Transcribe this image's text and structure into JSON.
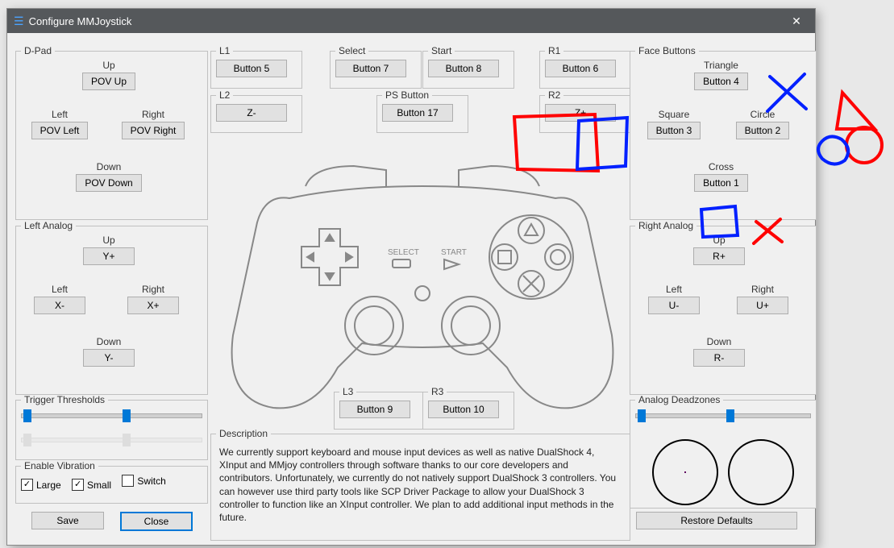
{
  "window": {
    "title": "Configure MMJoystick"
  },
  "dpad": {
    "legend": "D-Pad",
    "up_lbl": "Up",
    "up_btn": "POV Up",
    "left_lbl": "Left",
    "left_btn": "POV Left",
    "right_lbl": "Right",
    "right_btn": "POV Right",
    "down_lbl": "Down",
    "down_btn": "POV Down"
  },
  "left_analog": {
    "legend": "Left Analog",
    "up_lbl": "Up",
    "up_btn": "Y+",
    "left_lbl": "Left",
    "left_btn": "X-",
    "right_lbl": "Right",
    "right_btn": "X+",
    "down_lbl": "Down",
    "down_btn": "Y-"
  },
  "trigger_thresholds": {
    "legend": "Trigger Thresholds"
  },
  "enable_vibration": {
    "legend": "Enable Vibration",
    "large": "Large",
    "small": "Small",
    "switch": "Switch",
    "large_checked": true,
    "small_checked": true,
    "switch_checked": false
  },
  "save_btn": "Save",
  "close_btn": "Close",
  "l1": {
    "legend": "L1",
    "btn": "Button 5"
  },
  "l2": {
    "legend": "L2",
    "btn": "Z-"
  },
  "select": {
    "legend": "Select",
    "btn": "Button 7"
  },
  "start": {
    "legend": "Start",
    "btn": "Button 8"
  },
  "ps": {
    "legend": "PS Button",
    "btn": "Button 17"
  },
  "r1": {
    "legend": "R1",
    "btn": "Button 6"
  },
  "r2": {
    "legend": "R2",
    "btn": "Z+"
  },
  "l3": {
    "legend": "L3",
    "btn": "Button 9"
  },
  "r3": {
    "legend": "R3",
    "btn": "Button 10"
  },
  "description": {
    "legend": "Description",
    "text": "We currently support keyboard and mouse input devices as well as native DualShock 4, XInput and MMjoy controllers through software thanks to our core developers and contributors. Unfortunately, we currently do not natively support DualShock 3 controllers. You can however use third party tools like SCP Driver Package to allow your DualShock 3 controller to function like an XInput controller. We plan to add additional input methods in the future."
  },
  "face_buttons": {
    "legend": "Face Buttons",
    "triangle_lbl": "Triangle",
    "triangle_btn": "Button 4",
    "square_lbl": "Square",
    "square_btn": "Button 3",
    "circle_lbl": "Circle",
    "circle_btn": "Button 2",
    "cross_lbl": "Cross",
    "cross_btn": "Button 1"
  },
  "right_analog": {
    "legend": "Right Analog",
    "up_lbl": "Up",
    "up_btn": "R+",
    "left_lbl": "Left",
    "left_btn": "U-",
    "right_lbl": "Right",
    "right_btn": "U+",
    "down_lbl": "Down",
    "down_btn": "R-"
  },
  "deadzones": {
    "legend": "Analog Deadzones"
  },
  "restore_btn": "Restore Defaults"
}
